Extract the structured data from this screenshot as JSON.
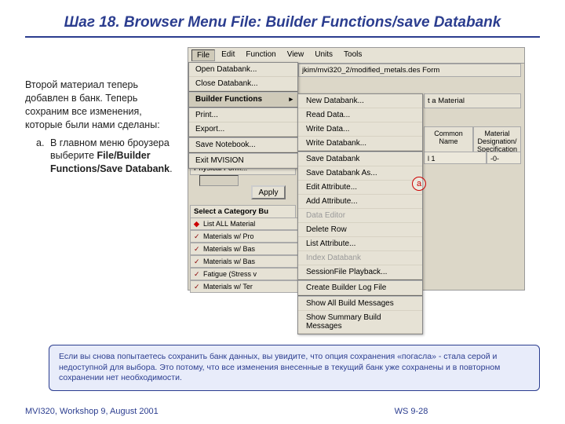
{
  "title": "Шаг 18.  Browser Menu File:  Builder Functions/save Databank",
  "left": {
    "p1": "Второй материал теперь добавлен в банк. Теперь сохраним все изменения, которые были нами сделаны:",
    "a_marker": "a.",
    "a_pre": "В главном меню броузера выберите ",
    "a_bold": "File/Builder Functions/Save Databank",
    "a_post": "."
  },
  "menubar": [
    "File",
    "Edit",
    "Function",
    "View",
    "Units",
    "Tools"
  ],
  "pathbar": "jkim/mvi320_2/modified_metals.des Form",
  "filemenu": {
    "open": "Open Databank...",
    "close": "Close Databank...",
    "builder": "Builder Functions",
    "print": "Print...",
    "export": "Export...",
    "saveNb": "Save Notebook...",
    "exit": "Exit MVISION"
  },
  "submenu": [
    {
      "t": "New Databank...",
      "d": false
    },
    {
      "t": "Read Data...",
      "d": false
    },
    {
      "t": "Write Data...",
      "d": false
    },
    {
      "t": "Write Databank...",
      "d": false
    },
    {
      "sep": true
    },
    {
      "t": "Save Databank",
      "d": false
    },
    {
      "t": "Save Databank As...",
      "d": false
    },
    {
      "t": "Edit Attribute...",
      "d": false
    },
    {
      "t": "Add Attribute...",
      "d": false
    },
    {
      "t": "Data Editor",
      "d": true
    },
    {
      "t": "Delete Row",
      "d": false
    },
    {
      "t": "List Attribute...",
      "d": false
    },
    {
      "t": "Index Databank",
      "d": true
    },
    {
      "t": "SessionFile Playback...",
      "d": false
    },
    {
      "sep": true
    },
    {
      "t": "Create Builder Log File",
      "d": false
    },
    {
      "sep": true
    },
    {
      "t": "Show All Build Messages",
      "d": false
    },
    {
      "t": "Show Summary Build Messages",
      "d": false
    }
  ],
  "bgrow": "t a Material",
  "tbl": {
    "h1": "Common Name",
    "h2": "Material Designation/ Specification",
    "c1": "l 1",
    "c2": "-0-"
  },
  "physform": "Physical Form...",
  "apply": "Apply",
  "catlabel": "Select a Category Bu",
  "catlist": [
    "List ALL Material",
    "Materials w/ Pro",
    "Materials w/ Bas",
    "Materials w/ Bas",
    "Fatigue (Stress v",
    "Materials w/ Ter"
  ],
  "annot": "a",
  "note": "Если вы снова попытаетесь сохранить банк данных, вы увидите, что опция сохранения «погасла» - стала серой и недоступной для выбора. Это потому, что все изменения внесенные в текущий банк уже сохранены и в повторном сохранении нет необходимости.",
  "footer": {
    "left": "MVI320, Workshop 9, August 2001",
    "center": "WS 9-28"
  }
}
